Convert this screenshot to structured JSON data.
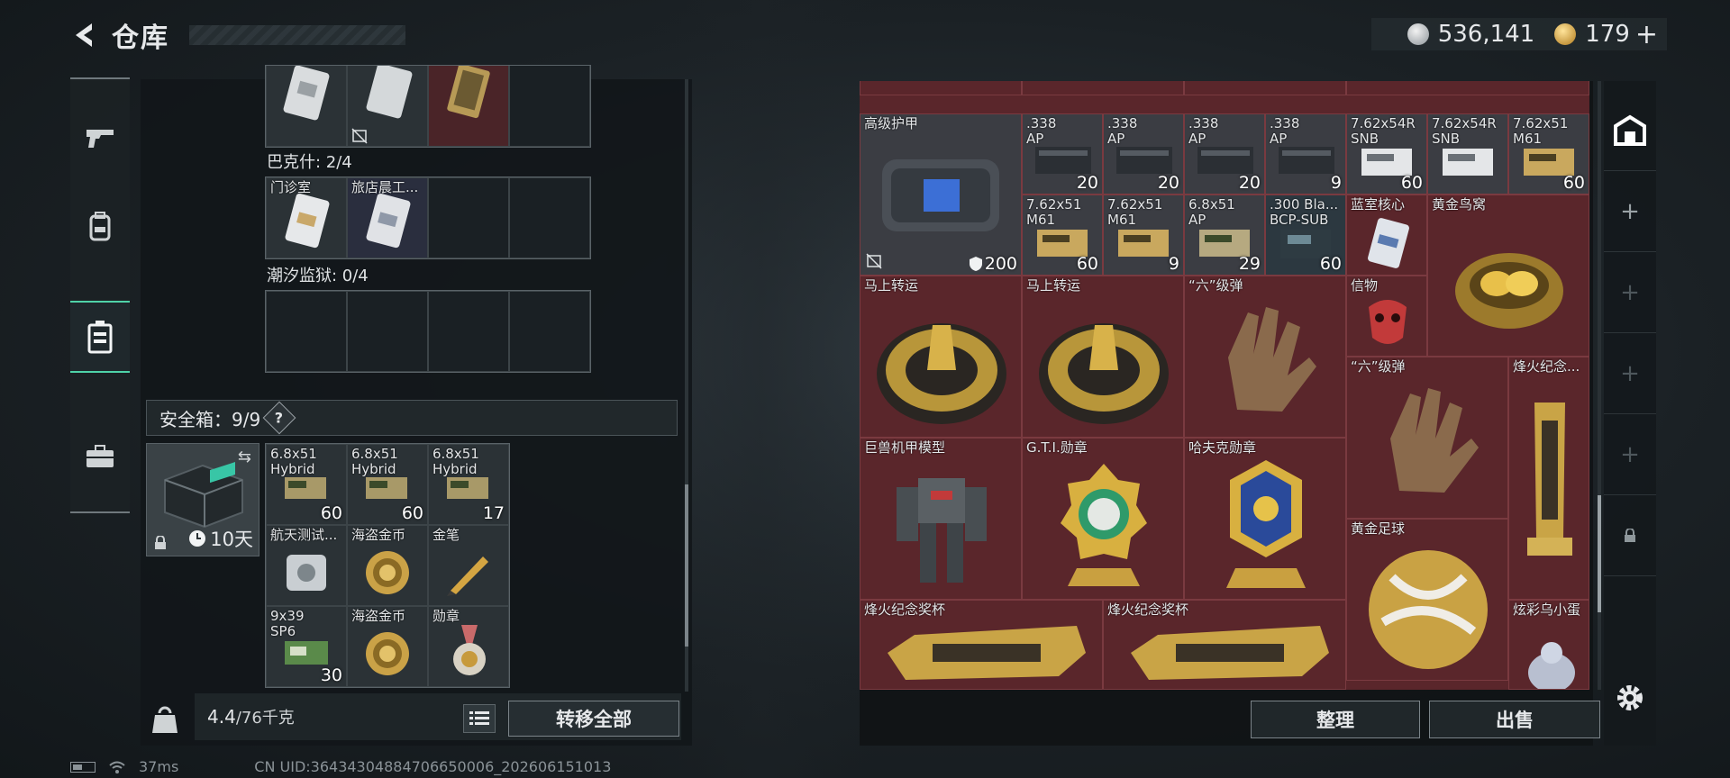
{
  "header": {
    "title": "仓库"
  },
  "currency": {
    "silver": "536,141",
    "gold": "179",
    "plus": "+"
  },
  "sections": {
    "bakeshi": "巴克什: 2/4",
    "chaoxi": "潮汐监狱: 0/4"
  },
  "top_grid": [
    {
      "label": "",
      "qty": "",
      "style": "it"
    },
    {
      "label": "",
      "qty": "",
      "style": "it"
    },
    {
      "label": "",
      "qty": "",
      "style": "red"
    },
    {
      "label": "",
      "qty": "",
      "style": ""
    }
  ],
  "bakeshi_grid": [
    {
      "label": "门诊室",
      "qty": "",
      "style": "it"
    },
    {
      "label": "旅店晨工...",
      "qty": "",
      "style": "blue"
    },
    {
      "label": "",
      "qty": "",
      "style": ""
    },
    {
      "label": "",
      "qty": "",
      "style": ""
    }
  ],
  "safebox": {
    "title": "安全箱：9/9",
    "help": "?",
    "days": "10天"
  },
  "safe_items": [
    {
      "label": "6.8x51 Hybrid",
      "qty": "60"
    },
    {
      "label": "6.8x51 Hybrid",
      "qty": "60"
    },
    {
      "label": "6.8x51 Hybrid",
      "qty": "17"
    },
    {
      "label": "航天测试...",
      "qty": ""
    },
    {
      "label": "海盗金币",
      "qty": ""
    },
    {
      "label": "金笔",
      "qty": ""
    },
    {
      "label": "9x39 SP6",
      "qty": "30"
    },
    {
      "label": "海盗金币",
      "qty": ""
    },
    {
      "label": "勋章",
      "qty": ""
    }
  ],
  "weight": {
    "current": "4.4",
    "max": "/76千克"
  },
  "buttons": {
    "transfer_all": "转移全部",
    "sort": "整理",
    "sell": "出售"
  },
  "stash_items": [
    {
      "label": "高级护甲",
      "qty": "200"
    },
    {
      "label": ".338 AP",
      "qty": "20"
    },
    {
      "label": ".338 AP",
      "qty": "20"
    },
    {
      "label": ".338 AP",
      "qty": "20"
    },
    {
      "label": ".338 AP",
      "qty": "9"
    },
    {
      "label": "7.62x54R SNB",
      "qty": "60"
    },
    {
      "label": "7.62x54R SNB",
      "qty": ""
    },
    {
      "label": "7.62x51 M61",
      "qty": "60"
    },
    {
      "label": "7.62x51 M61",
      "qty": "60"
    },
    {
      "label": "7.62x51 M61",
      "qty": "9"
    },
    {
      "label": "6.8x51 AP",
      "qty": "29"
    },
    {
      "label": ".300 Bla... BCP-SUB",
      "qty": "60"
    },
    {
      "label": "蓝室核心",
      "qty": ""
    },
    {
      "label": "黄金鸟窝",
      "qty": ""
    },
    {
      "label": "马上转运",
      "qty": ""
    },
    {
      "label": "马上转运",
      "qty": ""
    },
    {
      "label": "“六”级弹",
      "qty": ""
    },
    {
      "label": "信物",
      "qty": ""
    },
    {
      "label": "“六”级弹",
      "qty": ""
    },
    {
      "label": "烽火纪念...",
      "qty": ""
    },
    {
      "label": "巨兽机甲模型",
      "qty": ""
    },
    {
      "label": "G.T.I.勋章",
      "qty": ""
    },
    {
      "label": "哈夫克勋章",
      "qty": ""
    },
    {
      "label": "黄金足球",
      "qty": ""
    },
    {
      "label": "烽火纪念奖杯",
      "qty": ""
    },
    {
      "label": "烽火纪念奖杯",
      "qty": ""
    },
    {
      "label": "炫彩乌小蛋",
      "qty": ""
    }
  ],
  "status": {
    "ping": "37ms",
    "uid": "CN UID:36434304884706650006_202606151013"
  },
  "colors": {
    "accent": "#4fd3a8",
    "stash_bg": "#5a262b"
  }
}
